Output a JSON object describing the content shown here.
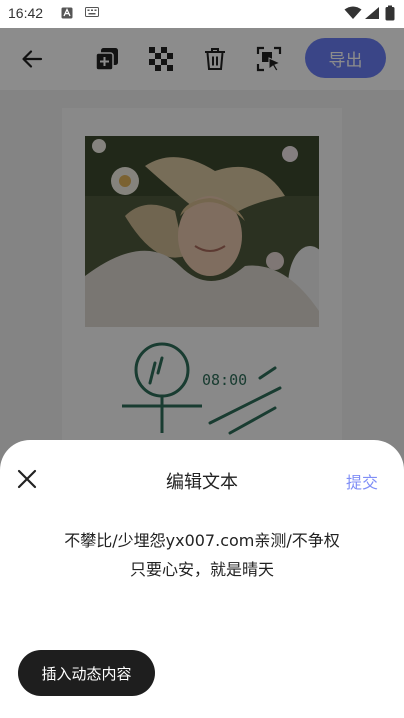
{
  "status_bar": {
    "time": "16:42"
  },
  "toolbar": {
    "back_icon": "arrow-left-icon",
    "tools": [
      "add-layer-icon",
      "mosaic-icon",
      "delete-icon",
      "crop-cursor-icon"
    ],
    "export_label": "导出"
  },
  "poster": {
    "time_text": "08:00"
  },
  "sheet": {
    "title": "编辑文本",
    "submit_label": "提交",
    "text_line_1": "不攀比/少埋怨yx007.com亲测/不争权",
    "text_line_2": "只要心安，就是晴天",
    "insert_label": "插入动态内容"
  },
  "colors": {
    "accent": "#6a7ff6",
    "submit": "#7f8ef6",
    "poster_green": "#2f6e5a",
    "insert_bg": "#1e1e1e"
  }
}
